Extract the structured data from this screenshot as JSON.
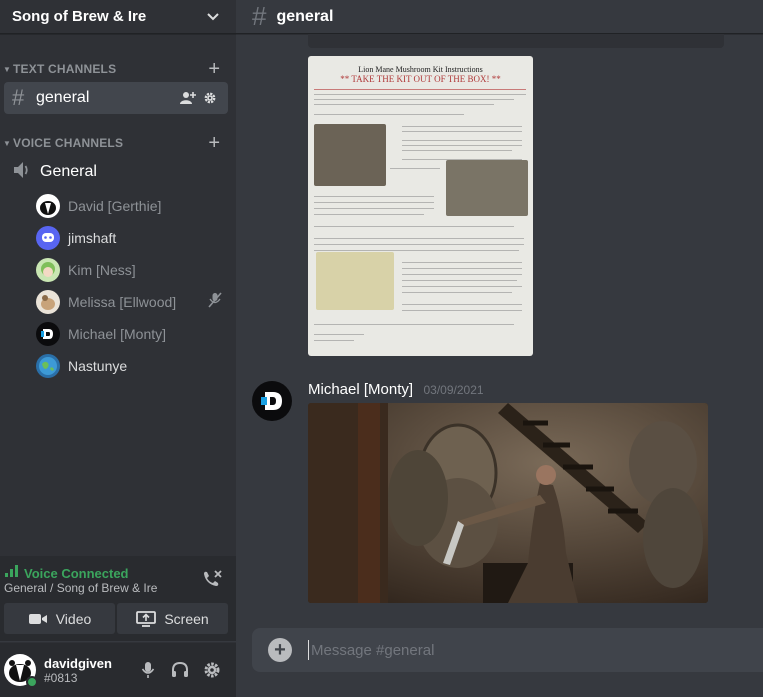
{
  "server": {
    "name": "Song of Brew & Ire"
  },
  "categories": {
    "text": "TEXT CHANNELS",
    "voice": "VOICE CHANNELS"
  },
  "text_channels": [
    {
      "name": "general",
      "selected": true
    }
  ],
  "voice_channel": {
    "name": "General",
    "users": [
      {
        "name": "David [Gerthie]",
        "avatar": "badger-avatar"
      },
      {
        "name": "jimshaft",
        "avatar": "discord-blue-avatar"
      },
      {
        "name": "Kim [Ness]",
        "avatar": "anime-green-avatar"
      },
      {
        "name": "Melissa [Ellwood]",
        "avatar": "dog-avatar",
        "muted": true
      },
      {
        "name": "Michael [Monty]",
        "avatar": "d-logo-avatar"
      },
      {
        "name": "Nastunye",
        "avatar": "earth-avatar"
      }
    ]
  },
  "voice_panel": {
    "status": "Voice Connected",
    "location": "General / Song of Brew & Ire",
    "video_label": "Video",
    "screen_label": "Screen"
  },
  "user": {
    "name": "davidgiven",
    "discriminator": "#0813",
    "status_color": "#3ba55d"
  },
  "channel_header": {
    "name": "general"
  },
  "document_image": {
    "title": "Lion Mane Mushroom Kit Instructions",
    "headline": "** TAKE THE KIT OUT OF THE BOX! **"
  },
  "message": {
    "author": "Michael [Monty]",
    "timestamp": "03/09/2021"
  },
  "composer": {
    "placeholder": "Message #general"
  },
  "colors": {
    "accent_green": "#3ba55d",
    "background": "#36393f",
    "sidebar": "#2f3136"
  }
}
